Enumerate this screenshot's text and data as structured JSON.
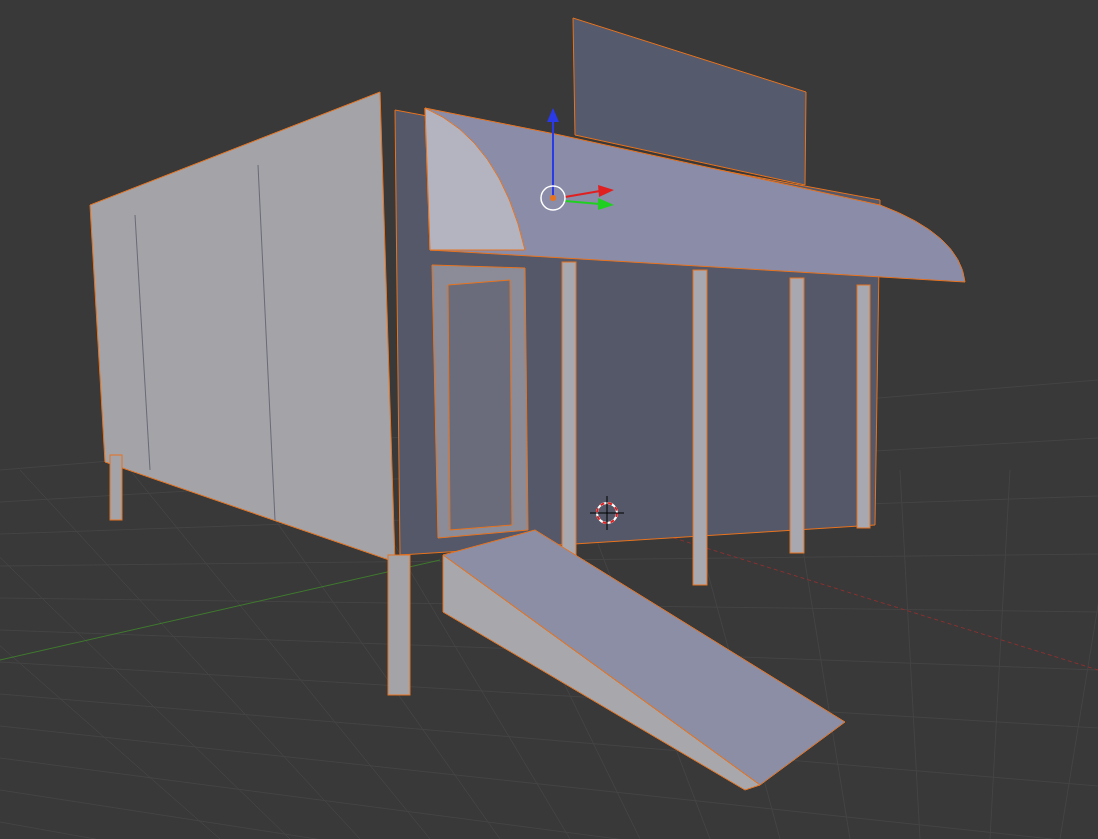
{
  "viewport": {
    "object_selected": true,
    "show_grid": true,
    "show_manipulator": true,
    "show_cursor": true
  }
}
